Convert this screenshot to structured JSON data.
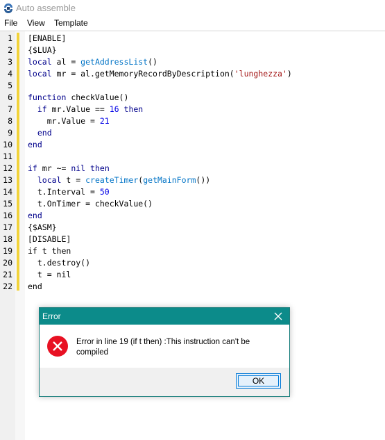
{
  "window": {
    "title": "Auto assemble",
    "app_icon": "cheat-engine-icon"
  },
  "menu": {
    "items": [
      "File",
      "View",
      "Template"
    ]
  },
  "editor": {
    "line_numbers": [
      "1",
      "2",
      "3",
      "4",
      "5",
      "6",
      "7",
      "8",
      "9",
      "10",
      "11",
      "12",
      "13",
      "14",
      "15",
      "16",
      "17",
      "18",
      "19",
      "20",
      "21",
      "22"
    ],
    "lines": [
      [
        {
          "t": "[ENABLE]",
          "c": "dir"
        }
      ],
      [
        {
          "t": "{$LUA}",
          "c": "dir"
        }
      ],
      [
        {
          "t": "local",
          "c": "kw"
        },
        {
          "t": " al = ",
          "c": ""
        },
        {
          "t": "getAddressList",
          "c": "fn"
        },
        {
          "t": "()",
          "c": ""
        }
      ],
      [
        {
          "t": "local",
          "c": "kw"
        },
        {
          "t": " mr = al.getMemoryRecordByDescription(",
          "c": ""
        },
        {
          "t": "'lunghezza'",
          "c": "str"
        },
        {
          "t": ")",
          "c": ""
        }
      ],
      [],
      [
        {
          "t": "function",
          "c": "kw"
        },
        {
          "t": " checkValue()",
          "c": ""
        }
      ],
      [
        {
          "t": "  ",
          "c": ""
        },
        {
          "t": "if",
          "c": "kw"
        },
        {
          "t": " mr.Value == ",
          "c": ""
        },
        {
          "t": "16",
          "c": "num"
        },
        {
          "t": " ",
          "c": ""
        },
        {
          "t": "then",
          "c": "kw"
        }
      ],
      [
        {
          "t": "    mr.Value = ",
          "c": ""
        },
        {
          "t": "21",
          "c": "num"
        }
      ],
      [
        {
          "t": "  ",
          "c": ""
        },
        {
          "t": "end",
          "c": "kw"
        }
      ],
      [
        {
          "t": "end",
          "c": "kw"
        }
      ],
      [],
      [
        {
          "t": "if",
          "c": "kw"
        },
        {
          "t": " mr ~= ",
          "c": ""
        },
        {
          "t": "nil",
          "c": "kw"
        },
        {
          "t": " ",
          "c": ""
        },
        {
          "t": "then",
          "c": "kw"
        }
      ],
      [
        {
          "t": "  ",
          "c": ""
        },
        {
          "t": "local",
          "c": "kw"
        },
        {
          "t": " t = ",
          "c": ""
        },
        {
          "t": "createTimer",
          "c": "fn"
        },
        {
          "t": "(",
          "c": ""
        },
        {
          "t": "getMainForm",
          "c": "fn"
        },
        {
          "t": "())",
          "c": ""
        }
      ],
      [
        {
          "t": "  t.Interval = ",
          "c": ""
        },
        {
          "t": "50",
          "c": "num"
        }
      ],
      [
        {
          "t": "  t.OnTimer = checkValue()",
          "c": ""
        }
      ],
      [
        {
          "t": "end",
          "c": "kw"
        }
      ],
      [
        {
          "t": "{$ASM}",
          "c": "dir"
        }
      ],
      [
        {
          "t": "[DISABLE]",
          "c": "dir"
        }
      ],
      [
        {
          "t": "if t then",
          "c": ""
        }
      ],
      [
        {
          "t": "  t.destroy()",
          "c": ""
        }
      ],
      [
        {
          "t": "  t = nil",
          "c": ""
        }
      ],
      [
        {
          "t": "end",
          "c": ""
        }
      ]
    ]
  },
  "dialog": {
    "title": "Error",
    "close_icon": "close-icon",
    "status_icon": "error-icon",
    "message": "Error in line 19 (if t then) :This instruction can't be compiled",
    "ok_label": "OK"
  },
  "colors": {
    "dialog_titlebar": "#0c8b8a",
    "change_bar": "#f2d33b",
    "keyword": "#00008b",
    "function": "#0073c6",
    "number": "#0000e6",
    "string": "#a31515",
    "error_red": "#e81123"
  }
}
